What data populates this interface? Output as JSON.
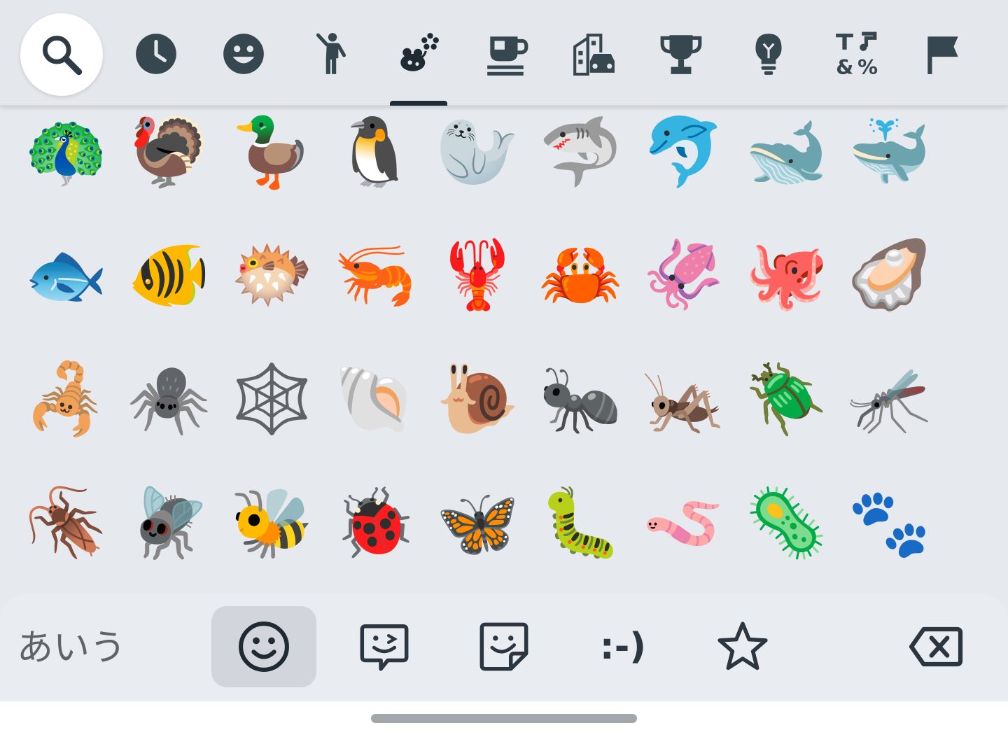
{
  "colors": {
    "bar_bg": "#e4e7ec",
    "icon_dark": "#37474f",
    "active": "#1f2a33",
    "search_bg": "#ffffff",
    "tool_active_bg": "#d2d6dc"
  },
  "categories": [
    {
      "icon": "search-icon",
      "active": false
    },
    {
      "icon": "clock-icon",
      "active": false
    },
    {
      "icon": "smiley-icon",
      "active": false
    },
    {
      "icon": "person-icon",
      "active": false
    },
    {
      "icon": "animals-nature-icon",
      "active": true
    },
    {
      "icon": "food-drink-icon",
      "active": false
    },
    {
      "icon": "travel-places-icon",
      "active": false
    },
    {
      "icon": "activities-trophy-icon",
      "active": false
    },
    {
      "icon": "objects-bulb-icon",
      "active": false
    },
    {
      "icon": "symbols-icon",
      "active": false
    },
    {
      "icon": "flags-icon",
      "active": false
    }
  ],
  "emoji_rows": [
    [
      "🦚",
      "🦃",
      "🦆",
      "🐧",
      "🦭",
      "🦈",
      "🐬",
      "🐋",
      "🐳"
    ],
    [
      "🐟",
      "🐠",
      "🐡",
      "🦐",
      "🦞",
      "🦀",
      "🦑",
      "🐙",
      "🦪"
    ],
    [
      "🦂",
      "🕷️",
      "🕸️",
      "🐚",
      "🐌",
      "🐜",
      "🦗",
      "🪲",
      "🦟"
    ],
    [
      "🪳",
      "🪰",
      "🐝",
      "🐞",
      "🦋",
      "🐛",
      "🪱",
      "🦠",
      "🐾"
    ]
  ],
  "bottom_bar": {
    "ime_label": "あいう",
    "emoticon_label": ":-)",
    "tools": [
      {
        "icon": "emoji-smiley-icon",
        "active": true
      },
      {
        "icon": "gif-icon",
        "active": false
      },
      {
        "icon": "sticker-icon",
        "active": false
      },
      {
        "icon": "emoticon-icon",
        "active": false
      },
      {
        "icon": "star-icon",
        "active": false
      },
      {
        "icon": "backspace-icon",
        "active": false
      }
    ]
  }
}
